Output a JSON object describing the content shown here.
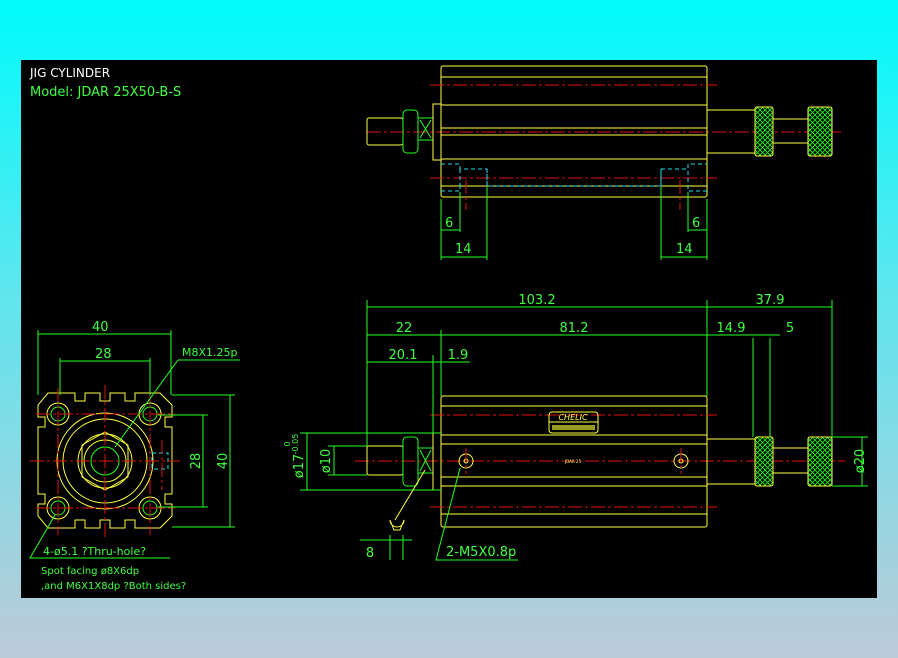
{
  "title": {
    "heading": "JIG CYLINDER",
    "model": "Model:  JDAR 25X50-B-S"
  },
  "colors": {
    "background_top": "#00fbfb",
    "background_bottom": "#bccad8",
    "canvas": "#000000",
    "outline": "#ffff40",
    "dimension": "#20ff20",
    "centerline": "#e01010",
    "hidden": "#20e0f0"
  },
  "top_view": {
    "dims": {
      "left_6": "6",
      "left_14": "14",
      "right_6": "6",
      "right_14": "14"
    }
  },
  "side_view": {
    "dims": {
      "width_40": "40",
      "width_28": "28",
      "height_28": "28",
      "height_40": "40"
    },
    "thread_label": "M8X1.25p",
    "notes": [
      "4-ø5.1 ?Thru-hole?",
      "Spot facing  ø8X6dp",
      ",and M6X1X8dp ?Both sides?"
    ]
  },
  "front_view": {
    "dims": {
      "overall": "103.2",
      "right_ext": "37.9",
      "rod_len": "22",
      "body_len": "81.2",
      "knob_len": "14.9",
      "knob_w": "5",
      "nut_pos": "20.1",
      "flange": "1.9",
      "wrench": "8"
    },
    "diameters": {
      "bore": "ø17",
      "bore_tol_upper": "0",
      "bore_tol_lower": "-0.05",
      "rod": "ø10",
      "knob": "ø20"
    },
    "port_label": "2-M5X0.8p",
    "brand_label": "CHELIC",
    "body_mark": "JDAR 25"
  }
}
